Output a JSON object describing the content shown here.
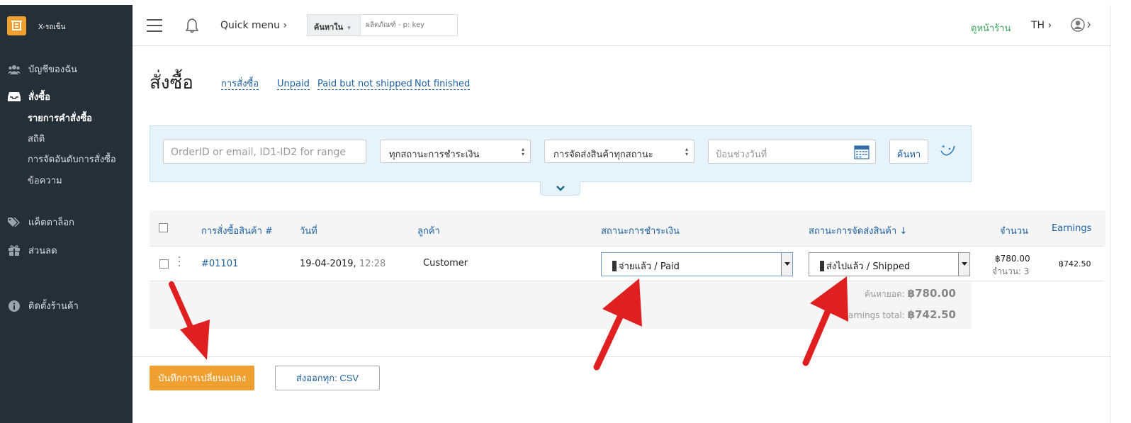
{
  "brand": {
    "name": "X-รถเข็น",
    "accent": "#f0a030"
  },
  "sidebar": {
    "items": [
      {
        "label": "บัญชีของฉัน",
        "icon": "users-icon"
      },
      {
        "label": "สั่งซื้อ",
        "icon": "inbox-icon"
      },
      {
        "label": "แค็ตตาล็อก",
        "icon": "tags-icon"
      },
      {
        "label": "ส่วนลด",
        "icon": "gift-icon"
      },
      {
        "label": "ติดตั้งร้านค้า",
        "icon": "info-icon"
      }
    ],
    "subitems": [
      "รายการคำสั่งซื้อ",
      "สถิติ",
      "การจัดอันดับการสั่งซื้อ",
      "ข้อความ"
    ]
  },
  "topbar": {
    "quick_menu": "Quick menu",
    "search_scope": "ค้นหาใน",
    "search_placeholder": "ผลิตภัณฑ์ - p: key",
    "storefront": "ดูหน้าร้าน",
    "lang": "TH"
  },
  "page": {
    "title": "สั่งซื้อ",
    "tabs": [
      "การสั่งซื้อ",
      "Unpaid",
      "Paid but not shipped",
      "Not finished"
    ]
  },
  "filter": {
    "search_placeholder": "OrderID or email, ID1-ID2 for range",
    "payment_status": "ทุกสถานะการชำระเงิน",
    "shipping_status": "การจัดส่งสินค้าทุกสถานะ",
    "date_placeholder": "ป้อนช่วงวันที่",
    "search_button": "ค้นหา"
  },
  "table": {
    "headers": [
      "การสั่งซื้อสินค้า #",
      "วันที่",
      "ลูกค้า",
      "สถานะการชำระเงิน",
      "สถานะการจัดส่งสินค้า ↓",
      "จำนวน",
      "Earnings"
    ],
    "rows": [
      {
        "order_id": "#01101",
        "date": "19-04-2019,",
        "time": "12:28",
        "customer": "Customer",
        "payment_status": "จ่ายแล้ว / Paid",
        "shipping_status": "ส่งไปแล้ว / Shipped",
        "amount": "฿780.00",
        "quantity": "จำนวน: 3",
        "earnings": "฿742.50"
      }
    ]
  },
  "summary": {
    "total_label": "ค้นหายอด:",
    "total_value": "฿780.00",
    "earnings_label": "Earnings total:",
    "earnings_value": "฿742.50"
  },
  "actions": {
    "save": "บันทึกการเปลี่ยนแปลง",
    "export": "ส่งออกทุก: CSV"
  },
  "annotations": {
    "arrow_color": "#e02020",
    "count": 3
  }
}
